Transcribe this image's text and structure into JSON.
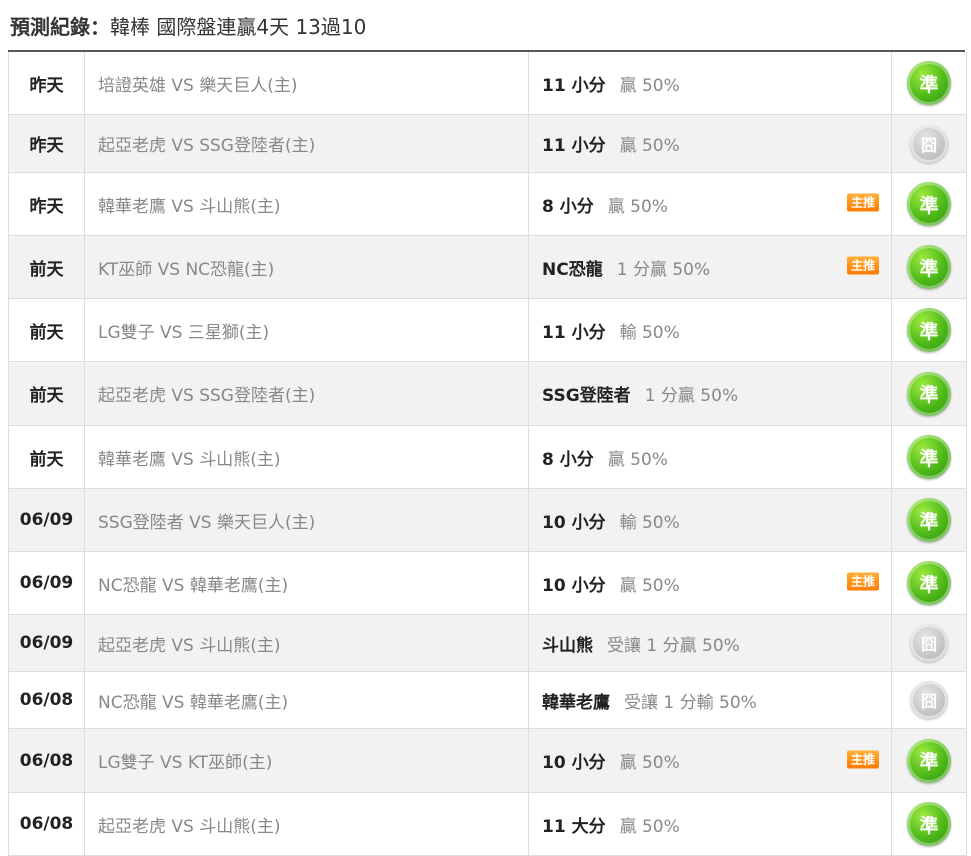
{
  "header": {
    "title_label": "預測紀錄：",
    "title_summary": "韓棒 國際盤連贏4天 13過10"
  },
  "colors": {
    "win": "#4cb718",
    "push": "#bdbdbd",
    "badge": "#ff8c1a"
  },
  "rows": [
    {
      "day": "昨天",
      "match": "培證英雄 VS 樂天巨人(主)",
      "pick": "11 小分",
      "detail": "贏 50%",
      "badge": "",
      "result": "準",
      "result_type": "win"
    },
    {
      "day": "昨天",
      "match": "起亞老虎 VS SSG登陸者(主)",
      "pick": "11 小分",
      "detail": "贏 50%",
      "badge": "",
      "result": "囧",
      "result_type": "push"
    },
    {
      "day": "昨天",
      "match": "韓華老鷹 VS 斗山熊(主)",
      "pick": "8 小分",
      "detail": "贏 50%",
      "badge": "主推",
      "result": "準",
      "result_type": "win"
    },
    {
      "day": "前天",
      "match": "KT巫師 VS NC恐龍(主)",
      "pick": "NC恐龍",
      "detail": "1 分贏 50%",
      "badge": "主推",
      "result": "準",
      "result_type": "win"
    },
    {
      "day": "前天",
      "match": "LG雙子 VS 三星獅(主)",
      "pick": "11 小分",
      "detail": "輸 50%",
      "badge": "",
      "result": "準",
      "result_type": "win"
    },
    {
      "day": "前天",
      "match": "起亞老虎 VS SSG登陸者(主)",
      "pick": "SSG登陸者",
      "detail": "1 分贏 50%",
      "badge": "",
      "result": "準",
      "result_type": "win"
    },
    {
      "day": "前天",
      "match": "韓華老鷹 VS 斗山熊(主)",
      "pick": "8 小分",
      "detail": "贏 50%",
      "badge": "",
      "result": "準",
      "result_type": "win"
    },
    {
      "day": "06/09",
      "match": "SSG登陸者 VS 樂天巨人(主)",
      "pick": "10 小分",
      "detail": "輸 50%",
      "badge": "",
      "result": "準",
      "result_type": "win"
    },
    {
      "day": "06/09",
      "match": "NC恐龍 VS 韓華老鷹(主)",
      "pick": "10 小分",
      "detail": "贏 50%",
      "badge": "主推",
      "result": "準",
      "result_type": "win"
    },
    {
      "day": "06/09",
      "match": "起亞老虎 VS 斗山熊(主)",
      "pick": "斗山熊",
      "detail": "受讓 1 分贏 50%",
      "badge": "",
      "result": "囧",
      "result_type": "push"
    },
    {
      "day": "06/08",
      "match": "NC恐龍 VS 韓華老鷹(主)",
      "pick": "韓華老鷹",
      "detail": "受讓 1 分輸 50%",
      "badge": "",
      "result": "囧",
      "result_type": "push"
    },
    {
      "day": "06/08",
      "match": "LG雙子 VS KT巫師(主)",
      "pick": "10 小分",
      "detail": "贏 50%",
      "badge": "主推",
      "result": "準",
      "result_type": "win"
    },
    {
      "day": "06/08",
      "match": "起亞老虎 VS 斗山熊(主)",
      "pick": "11 大分",
      "detail": "贏 50%",
      "badge": "",
      "result": "準",
      "result_type": "win"
    }
  ]
}
